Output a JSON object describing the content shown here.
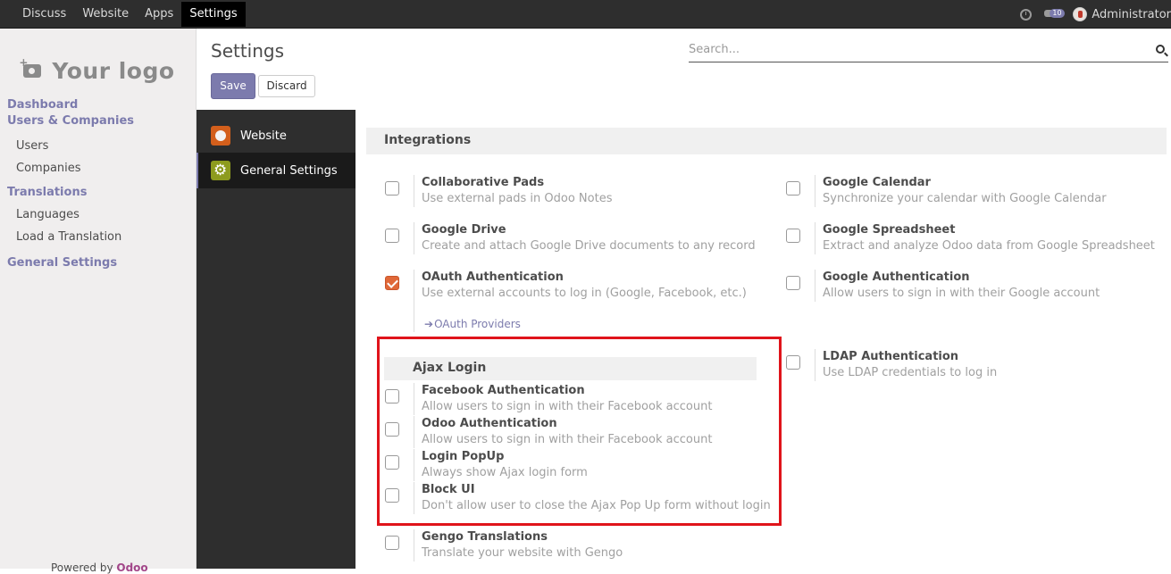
{
  "topbar": {
    "menu": [
      "Discuss",
      "Website",
      "Apps",
      "Settings"
    ],
    "active": "Settings",
    "chat_count": "10",
    "user": "Administrator"
  },
  "sidebar": {
    "logo_text": "Your logo",
    "sections": [
      {
        "label": "Dashboard",
        "items": []
      },
      {
        "label": "Users & Companies",
        "items": [
          "Users",
          "Companies"
        ]
      },
      {
        "label": "Translations",
        "items": [
          "Languages",
          "Load a Translation"
        ]
      },
      {
        "label": "General Settings",
        "items": []
      }
    ],
    "powered_prefix": "Powered by",
    "powered_brand": "Odoo"
  },
  "header": {
    "title": "Settings",
    "save_label": "Save",
    "discard_label": "Discard",
    "search_placeholder": "Search..."
  },
  "settings_nav": [
    {
      "label": "Website",
      "icon": "website-app-icon"
    },
    {
      "label": "General Settings",
      "icon": "gear-app-icon"
    }
  ],
  "content": {
    "section_title": "Integrations",
    "left_options": [
      {
        "title": "Collaborative Pads",
        "desc": "Use external pads in Odoo Notes",
        "checked": false
      },
      {
        "title": "Google Drive",
        "desc": "Create and attach Google Drive documents to any record",
        "checked": false
      },
      {
        "title": "OAuth Authentication",
        "desc": "Use external accounts to log in (Google, Facebook, etc.)",
        "checked": true
      }
    ],
    "oauth_link": "OAuth Providers",
    "right_options": [
      {
        "title": "Google Calendar",
        "desc": "Synchronize your calendar with Google Calendar",
        "checked": false
      },
      {
        "title": "Google Spreadsheet",
        "desc": "Extract and analyze Odoo data from Google Spreadsheet",
        "checked": false
      },
      {
        "title": "Google Authentication",
        "desc": "Allow users to sign in with their Google account",
        "checked": false
      },
      {
        "title": "LDAP Authentication",
        "desc": "Use LDAP credentials to log in",
        "checked": false
      }
    ],
    "ajax": {
      "title": "Ajax Login",
      "options": [
        {
          "title": "Facebook Authentication",
          "desc": "Allow users to sign in with their Facebook account",
          "checked": false
        },
        {
          "title": "Odoo Authentication",
          "desc": "Allow users to sign in with their Facebook account",
          "checked": false
        },
        {
          "title": "Login PopUp",
          "desc": "Always show Ajax login form",
          "checked": false
        },
        {
          "title": "Block UI",
          "desc": "Don't allow user to close the Ajax Pop Up form without login",
          "checked": false
        }
      ]
    },
    "gengo": {
      "title": "Gengo Translations",
      "desc": "Translate your website with Gengo",
      "checked": false
    }
  }
}
